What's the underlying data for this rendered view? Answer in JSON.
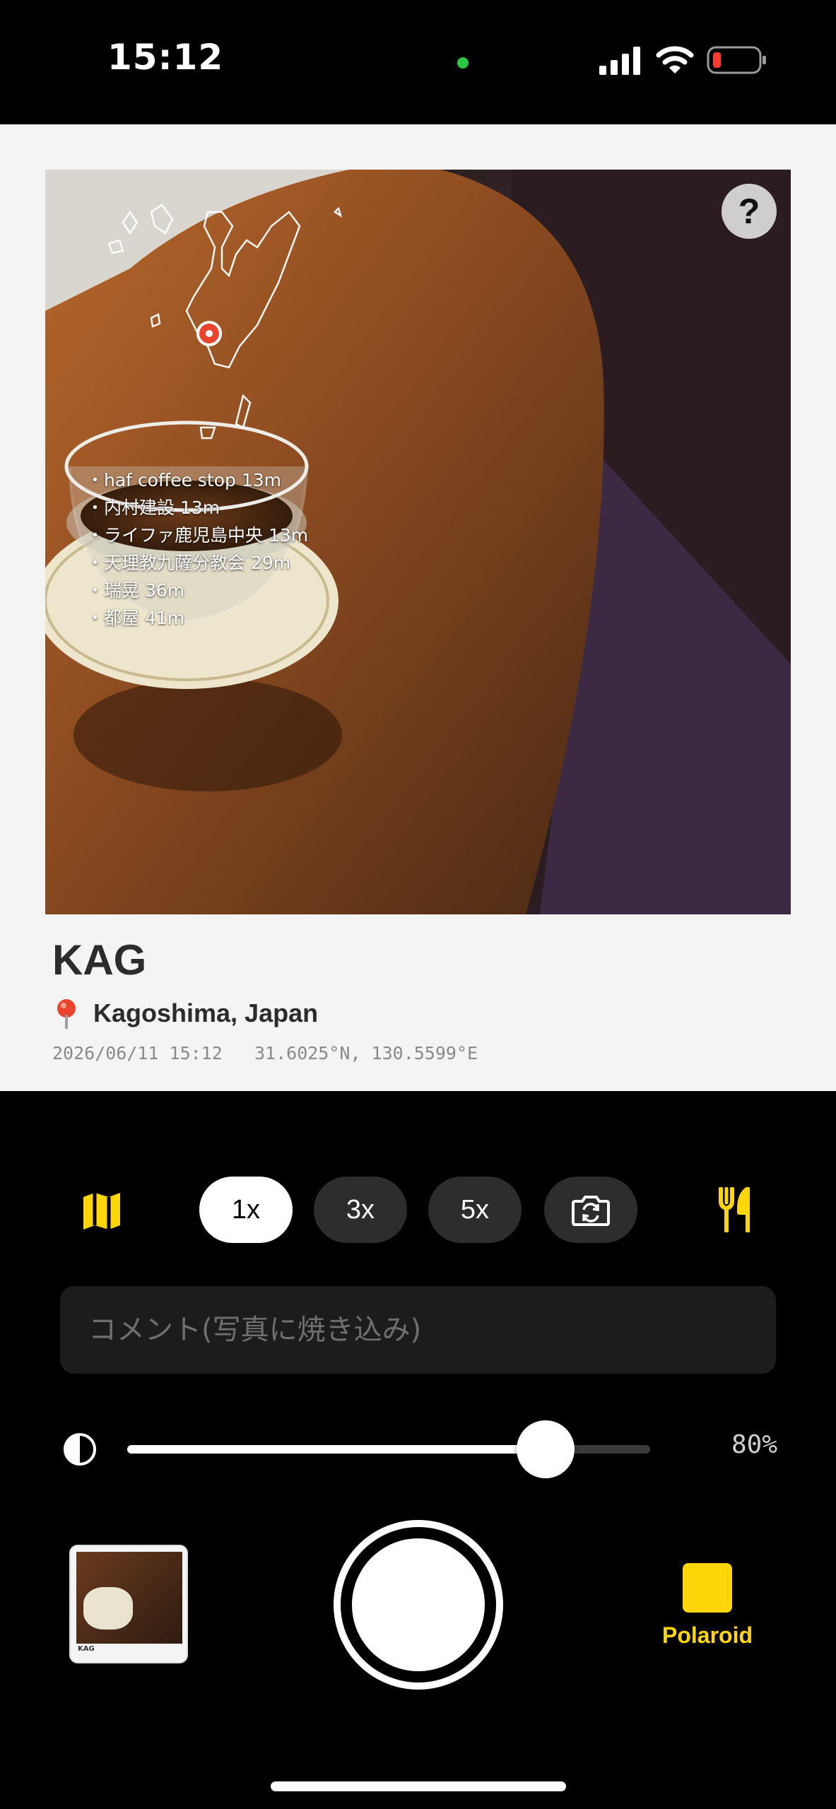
{
  "status_bar": {
    "time": "15:12"
  },
  "card": {
    "code": "KAG",
    "location": "Kagoshima, Japan",
    "datetime": "2026/06/11 15:12",
    "coordinates": "31.6025°N, 130.5599°E",
    "help_label": "?",
    "nearby": [
      "haf coffee stop 13m",
      "内村建設 13m",
      "ライファ鹿児島中央 13m",
      "天理教九薩分教会 29m",
      "瑞晃 36m",
      "都屋 41m"
    ]
  },
  "controls": {
    "zoom_options": [
      "1x",
      "3x",
      "5x"
    ],
    "selected_zoom": "1x",
    "comment_placeholder": "コメント(写真に焼き込み)",
    "opacity": {
      "value": 0.8,
      "label": "80%"
    },
    "mode_label": "Polaroid",
    "thumbnail_caption": "KAG"
  },
  "colors": {
    "accent": "#ffd60a",
    "pin": "#e8442e",
    "background": "#000000",
    "card": "#f4f4f4"
  },
  "icons": [
    "map-icon",
    "camera-flip-icon",
    "fork-knife-icon",
    "contrast-icon",
    "location-pin-icon",
    "help-icon"
  ]
}
